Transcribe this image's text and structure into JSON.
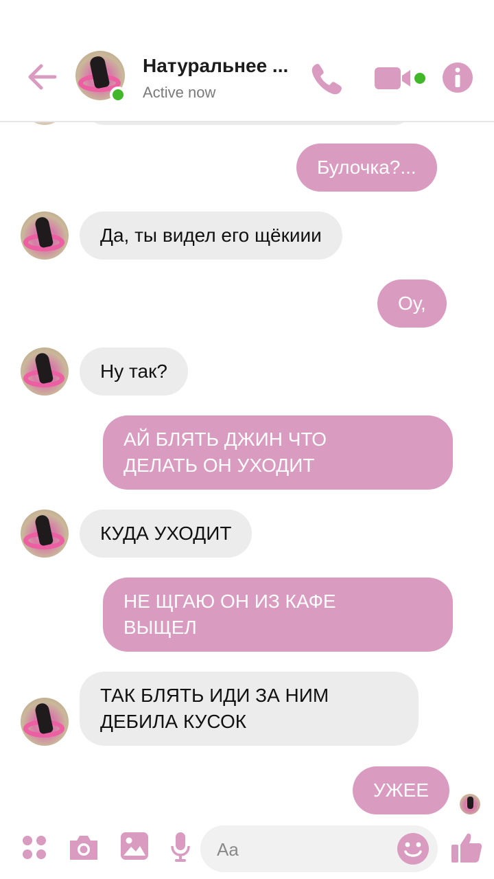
{
  "header": {
    "title": "Натуральнее ...",
    "status": "Active now"
  },
  "messages": [
    {
      "direction": "out",
      "lines": [
        "Булочка?..."
      ]
    },
    {
      "direction": "in",
      "lines": [
        "Да, ты видел его щёкиии"
      ]
    },
    {
      "direction": "out",
      "lines": [
        "Оу,"
      ]
    },
    {
      "direction": "in",
      "lines": [
        "Ну так?"
      ]
    },
    {
      "direction": "out",
      "lines": [
        "АЙ БЛЯТЬ ДЖИН ЧТО",
        "ДЕЛАТЬ ОН УХОДИТ"
      ]
    },
    {
      "direction": "in",
      "lines": [
        "КУДА УХОДИТ"
      ]
    },
    {
      "direction": "out",
      "lines": [
        "НЕ ЩГАЮ ОН ИЗ КАФЕ",
        "ВЫЩЕЛ"
      ]
    },
    {
      "direction": "in",
      "lines": [
        "ТАК БЛЯТЬ ИДИ ЗА НИМ",
        "ДЕБИЛА КУСОК"
      ]
    },
    {
      "direction": "out",
      "lines": [
        "УЖЕЕ"
      ]
    }
  ],
  "composer": {
    "placeholder": "Aa"
  },
  "colors": {
    "accent": "#d99bbf",
    "incoming_bubble": "#ececec",
    "online": "#42b72a"
  },
  "icons": [
    "back-arrow-icon",
    "phone-icon",
    "video-camera-icon",
    "info-icon",
    "apps-icon",
    "camera-icon",
    "gallery-icon",
    "microphone-icon",
    "emoji-icon",
    "thumbs-up-icon"
  ]
}
